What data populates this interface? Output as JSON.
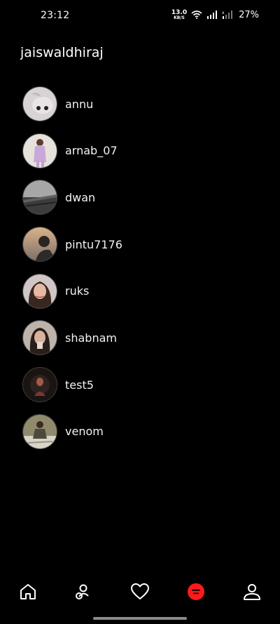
{
  "status_bar": {
    "time": "23:12",
    "net_speed_value": "13.0",
    "net_speed_unit": "KB/S",
    "battery": "27%"
  },
  "profile": {
    "title": "jaiswaldhiraj"
  },
  "users": [
    {
      "name": "annu"
    },
    {
      "name": "arnab_07"
    },
    {
      "name": "dwan"
    },
    {
      "name": "pintu7176"
    },
    {
      "name": "ruks"
    },
    {
      "name": "shabnam"
    },
    {
      "name": "test5"
    },
    {
      "name": "venom"
    }
  ],
  "bottom_nav": {
    "items": [
      "home-icon",
      "friends-icon",
      "heart-icon",
      "messages-icon",
      "profile-icon"
    ],
    "active_color": "#ff1a1a"
  }
}
